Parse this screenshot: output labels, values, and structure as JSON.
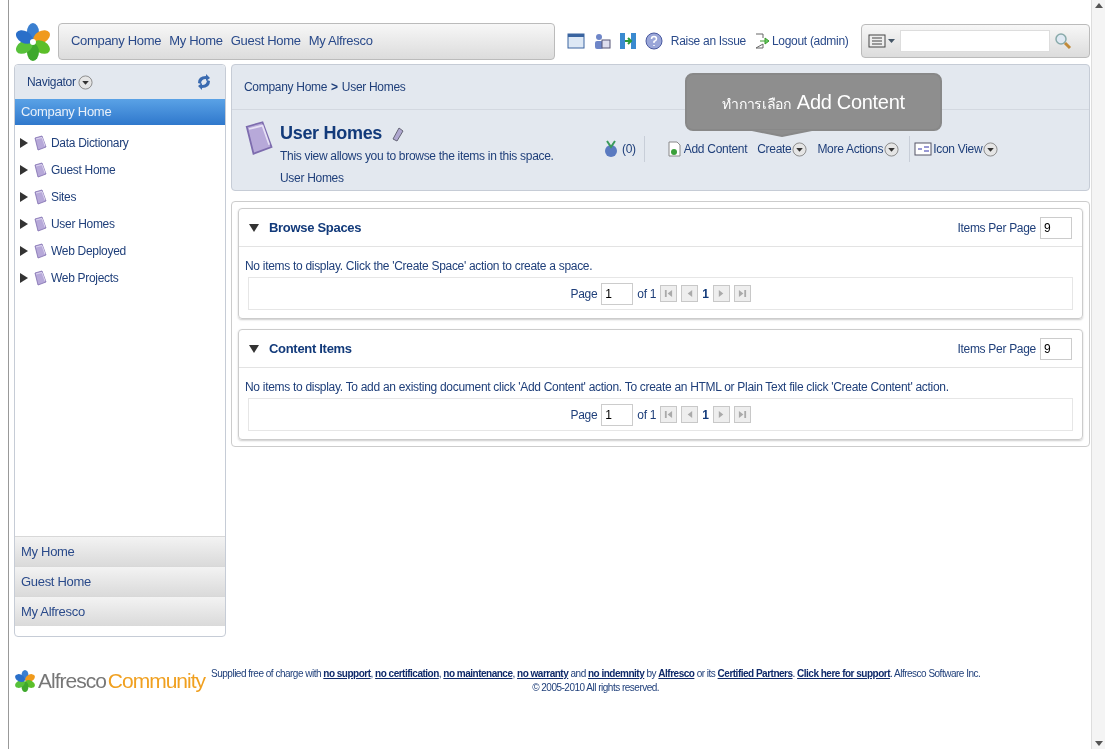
{
  "header": {
    "nav_links": [
      "Company Home",
      "My Home",
      "Guest Home",
      "My Alfresco"
    ],
    "top_links": [
      {
        "kind": "issue",
        "label": "Raise an Issue"
      },
      {
        "kind": "logout",
        "label": "Logout (admin)"
      }
    ]
  },
  "navigator": {
    "title": "Navigator",
    "selected": "Company Home",
    "items": [
      {
        "label": "Data Dictionary",
        "expanded": false
      },
      {
        "label": "Guest Home",
        "expanded": false
      },
      {
        "label": "Sites",
        "expanded": false
      },
      {
        "label": "User Homes",
        "expanded": false
      },
      {
        "label": "Web Deployed",
        "expanded": false
      },
      {
        "label": "Web Projects",
        "expanded": false
      }
    ],
    "bottom_panels": [
      "My Home",
      "Guest Home",
      "My Alfresco"
    ]
  },
  "breadcrumb": {
    "items": [
      "Company Home",
      "User Homes"
    ],
    "separator": ">"
  },
  "callout": {
    "prefix": "ทำการเลือก",
    "emphasis": "Add Content"
  },
  "space": {
    "title": "User Homes",
    "description": "This view allows you to browse the items in this space.",
    "path": "User Homes",
    "rss_count": "(0)",
    "actions": [
      {
        "kind": "add",
        "label": "Add Content"
      },
      {
        "kind": "menu",
        "label": "Create"
      },
      {
        "kind": "menu",
        "label": "More Actions"
      },
      {
        "kind": "view",
        "label": "Icon View"
      }
    ]
  },
  "panels": [
    {
      "title": "Browse Spaces",
      "items_per_page_label": "Items Per Page",
      "items_per_page": "9",
      "message": "No items to display. Click the 'Create Space' action to create a space.",
      "page_label": "Page",
      "page": "1",
      "of": "of 1",
      "current": "1"
    },
    {
      "title": "Content Items",
      "items_per_page_label": "Items Per Page",
      "items_per_page": "9",
      "message": "No items to display. To add an existing document click 'Add Content' action. To create an HTML or Plain Text file click 'Create Content' action.",
      "page_label": "Page",
      "page": "1",
      "of": "of 1",
      "current": "1"
    }
  ],
  "footer": {
    "brand": "Alfresco",
    "brand_suffix": "Community",
    "segments": [
      {
        "text": "Supplied free of charge with ",
        "link": false
      },
      {
        "text": "no support",
        "link": true
      },
      {
        "text": ", ",
        "link": false
      },
      {
        "text": "no certification",
        "link": true
      },
      {
        "text": ", ",
        "link": false
      },
      {
        "text": "no maintenance",
        "link": true
      },
      {
        "text": ", ",
        "link": false
      },
      {
        "text": "no warranty",
        "link": true
      },
      {
        "text": " and ",
        "link": false
      },
      {
        "text": "no indemnity",
        "link": true
      },
      {
        "text": " by ",
        "link": false
      },
      {
        "text": "Alfresco",
        "link": true
      },
      {
        "text": " or its ",
        "link": false
      },
      {
        "text": "Certified Partners",
        "link": true
      },
      {
        "text": ". ",
        "link": false
      },
      {
        "text": "Click here for support",
        "link": true
      },
      {
        "text": ". Alfresco Software Inc.",
        "link": false
      }
    ],
    "copyright": "© 2005-2010 All rights reserved."
  }
}
